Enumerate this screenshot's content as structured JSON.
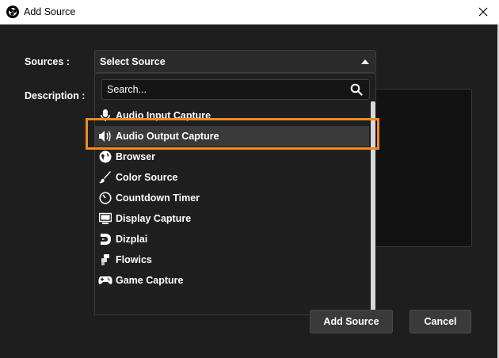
{
  "window": {
    "title": "Add Source"
  },
  "form": {
    "sources_label": "Sources :",
    "description_label": "Description :",
    "select_value": "Select Source"
  },
  "dropdown": {
    "search_placeholder": "Search...",
    "items": [
      {
        "label": "Audio Input Capture",
        "icon": "microphone-icon"
      },
      {
        "label": "Audio Output Capture",
        "icon": "speaker-icon",
        "selected": true
      },
      {
        "label": "Browser",
        "icon": "globe-icon"
      },
      {
        "label": "Color Source",
        "icon": "brush-icon"
      },
      {
        "label": "Countdown Timer",
        "icon": "timer-icon"
      },
      {
        "label": "Display Capture",
        "icon": "monitor-icon"
      },
      {
        "label": "Dizplai",
        "icon": "dizplai-logo-icon"
      },
      {
        "label": "Flowics",
        "icon": "flowics-logo-icon"
      },
      {
        "label": "Game Capture",
        "icon": "gamepad-icon"
      }
    ]
  },
  "buttons": {
    "add_source": "Add Source",
    "cancel": "Cancel"
  },
  "colors": {
    "highlight": "#f08a24",
    "background": "#1e1e1e",
    "selected_row": "#3a3a3a"
  }
}
